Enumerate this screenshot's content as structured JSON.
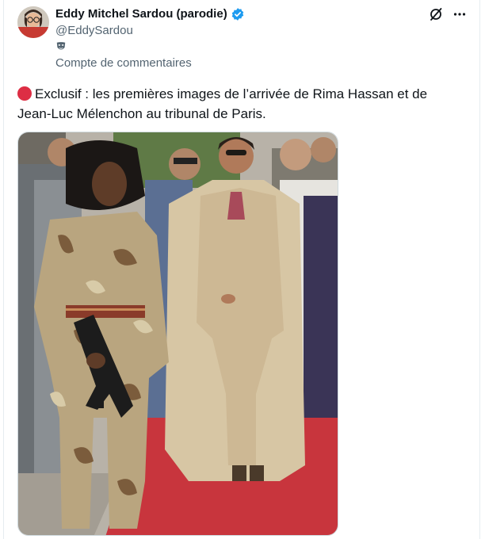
{
  "author": {
    "display_name": "Eddy Mitchel Sardou (parodie)",
    "handle": "@EddySardou",
    "verified": true,
    "badge_icon": "verified-badge-icon",
    "label_icon": "theater-mask-icon",
    "label": "Compte de commentaires"
  },
  "tweet": {
    "marker_icon": "red-circle-icon",
    "text": "Exclusif : les premières images de l’arrivée de Rima Hassan et de Jean-Luc Mélenchon au tribunal de Paris."
  },
  "actions": {
    "grok_icon": "grok-icon",
    "more_icon": "more-icon"
  },
  "colors": {
    "accent": "#1d9bf0",
    "marker": "#dd2e44",
    "secondary_text": "#536471",
    "carpet": "#c8353d"
  }
}
